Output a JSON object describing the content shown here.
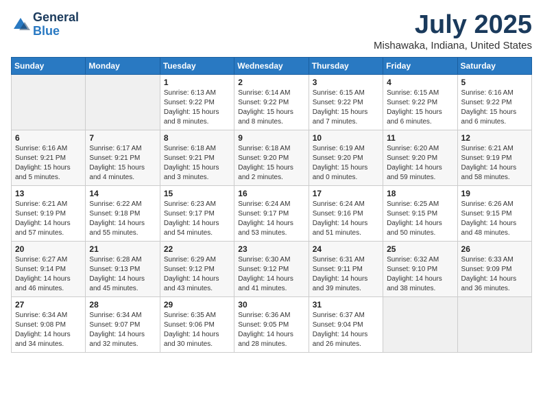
{
  "header": {
    "logo": {
      "line1": "General",
      "line2": "Blue"
    },
    "title": "July 2025",
    "subtitle": "Mishawaka, Indiana, United States"
  },
  "weekdays": [
    "Sunday",
    "Monday",
    "Tuesday",
    "Wednesday",
    "Thursday",
    "Friday",
    "Saturday"
  ],
  "weeks": [
    [
      {
        "day": "",
        "detail": ""
      },
      {
        "day": "",
        "detail": ""
      },
      {
        "day": "1",
        "detail": "Sunrise: 6:13 AM\nSunset: 9:22 PM\nDaylight: 15 hours\nand 8 minutes."
      },
      {
        "day": "2",
        "detail": "Sunrise: 6:14 AM\nSunset: 9:22 PM\nDaylight: 15 hours\nand 8 minutes."
      },
      {
        "day": "3",
        "detail": "Sunrise: 6:15 AM\nSunset: 9:22 PM\nDaylight: 15 hours\nand 7 minutes."
      },
      {
        "day": "4",
        "detail": "Sunrise: 6:15 AM\nSunset: 9:22 PM\nDaylight: 15 hours\nand 6 minutes."
      },
      {
        "day": "5",
        "detail": "Sunrise: 6:16 AM\nSunset: 9:22 PM\nDaylight: 15 hours\nand 6 minutes."
      }
    ],
    [
      {
        "day": "6",
        "detail": "Sunrise: 6:16 AM\nSunset: 9:21 PM\nDaylight: 15 hours\nand 5 minutes."
      },
      {
        "day": "7",
        "detail": "Sunrise: 6:17 AM\nSunset: 9:21 PM\nDaylight: 15 hours\nand 4 minutes."
      },
      {
        "day": "8",
        "detail": "Sunrise: 6:18 AM\nSunset: 9:21 PM\nDaylight: 15 hours\nand 3 minutes."
      },
      {
        "day": "9",
        "detail": "Sunrise: 6:18 AM\nSunset: 9:20 PM\nDaylight: 15 hours\nand 2 minutes."
      },
      {
        "day": "10",
        "detail": "Sunrise: 6:19 AM\nSunset: 9:20 PM\nDaylight: 15 hours\nand 0 minutes."
      },
      {
        "day": "11",
        "detail": "Sunrise: 6:20 AM\nSunset: 9:20 PM\nDaylight: 14 hours\nand 59 minutes."
      },
      {
        "day": "12",
        "detail": "Sunrise: 6:21 AM\nSunset: 9:19 PM\nDaylight: 14 hours\nand 58 minutes."
      }
    ],
    [
      {
        "day": "13",
        "detail": "Sunrise: 6:21 AM\nSunset: 9:19 PM\nDaylight: 14 hours\nand 57 minutes."
      },
      {
        "day": "14",
        "detail": "Sunrise: 6:22 AM\nSunset: 9:18 PM\nDaylight: 14 hours\nand 55 minutes."
      },
      {
        "day": "15",
        "detail": "Sunrise: 6:23 AM\nSunset: 9:17 PM\nDaylight: 14 hours\nand 54 minutes."
      },
      {
        "day": "16",
        "detail": "Sunrise: 6:24 AM\nSunset: 9:17 PM\nDaylight: 14 hours\nand 53 minutes."
      },
      {
        "day": "17",
        "detail": "Sunrise: 6:24 AM\nSunset: 9:16 PM\nDaylight: 14 hours\nand 51 minutes."
      },
      {
        "day": "18",
        "detail": "Sunrise: 6:25 AM\nSunset: 9:15 PM\nDaylight: 14 hours\nand 50 minutes."
      },
      {
        "day": "19",
        "detail": "Sunrise: 6:26 AM\nSunset: 9:15 PM\nDaylight: 14 hours\nand 48 minutes."
      }
    ],
    [
      {
        "day": "20",
        "detail": "Sunrise: 6:27 AM\nSunset: 9:14 PM\nDaylight: 14 hours\nand 46 minutes."
      },
      {
        "day": "21",
        "detail": "Sunrise: 6:28 AM\nSunset: 9:13 PM\nDaylight: 14 hours\nand 45 minutes."
      },
      {
        "day": "22",
        "detail": "Sunrise: 6:29 AM\nSunset: 9:12 PM\nDaylight: 14 hours\nand 43 minutes."
      },
      {
        "day": "23",
        "detail": "Sunrise: 6:30 AM\nSunset: 9:12 PM\nDaylight: 14 hours\nand 41 minutes."
      },
      {
        "day": "24",
        "detail": "Sunrise: 6:31 AM\nSunset: 9:11 PM\nDaylight: 14 hours\nand 39 minutes."
      },
      {
        "day": "25",
        "detail": "Sunrise: 6:32 AM\nSunset: 9:10 PM\nDaylight: 14 hours\nand 38 minutes."
      },
      {
        "day": "26",
        "detail": "Sunrise: 6:33 AM\nSunset: 9:09 PM\nDaylight: 14 hours\nand 36 minutes."
      }
    ],
    [
      {
        "day": "27",
        "detail": "Sunrise: 6:34 AM\nSunset: 9:08 PM\nDaylight: 14 hours\nand 34 minutes."
      },
      {
        "day": "28",
        "detail": "Sunrise: 6:34 AM\nSunset: 9:07 PM\nDaylight: 14 hours\nand 32 minutes."
      },
      {
        "day": "29",
        "detail": "Sunrise: 6:35 AM\nSunset: 9:06 PM\nDaylight: 14 hours\nand 30 minutes."
      },
      {
        "day": "30",
        "detail": "Sunrise: 6:36 AM\nSunset: 9:05 PM\nDaylight: 14 hours\nand 28 minutes."
      },
      {
        "day": "31",
        "detail": "Sunrise: 6:37 AM\nSunset: 9:04 PM\nDaylight: 14 hours\nand 26 minutes."
      },
      {
        "day": "",
        "detail": ""
      },
      {
        "day": "",
        "detail": ""
      }
    ]
  ]
}
